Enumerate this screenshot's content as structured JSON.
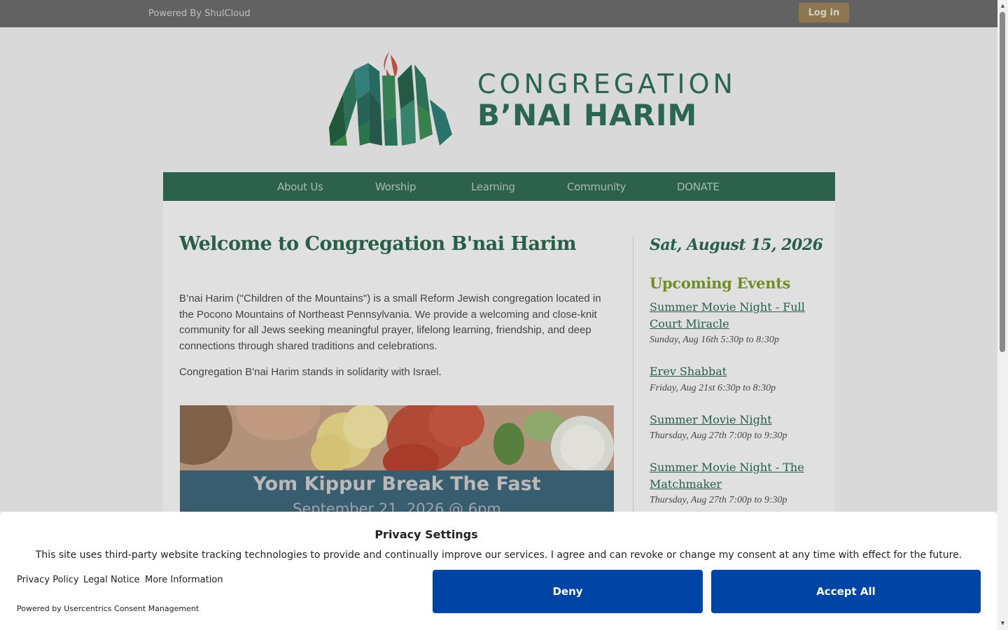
{
  "topbar": {
    "powered_by": "Powered By ShulCloud",
    "login_label": "Log in"
  },
  "logo": {
    "line1": "CONGREGATION",
    "line2": "B’NAI HARIM"
  },
  "nav": {
    "items": [
      "About Us",
      "Worship",
      "Learning",
      "Community",
      "DONATE"
    ]
  },
  "main": {
    "title": "Welcome to Congregation B'nai Harim",
    "paragraph1": "B’nai Harim (\"Children of the Mountains\") is a small Reform Jewish congregation located in the Pocono Mountains of Northeast Pennsylvania. We provide a welcoming and close-knit community for all Jews seeking meaningful prayer, lifelong learning, friendship, and deep connections through shared traditions and celebrations.",
    "paragraph2": "Congregation B'nai Harim stands in solidarity with Israel.",
    "banner": {
      "title": "Yom Kippur Break The Fast",
      "subtitle": "September 21, 2026 @ 6pm"
    }
  },
  "sidebar": {
    "date": "Sat, August 15, 2026",
    "upcoming_heading": "Upcoming Events",
    "events": [
      {
        "title": "Summer Movie Night - Full Court Miracle",
        "time": "Sunday, Aug 16th 5:30p to 8:30p"
      },
      {
        "title": "Erev Shabbat",
        "time": "Friday, Aug 21st 6:30p to 8:30p"
      },
      {
        "title": "Summer Movie Night",
        "time": "Thursday, Aug 27th 7:00p to 9:30p"
      },
      {
        "title": "Summer Movie Night - The Matchmaker",
        "time": "Thursday, Aug 27th 7:00p to 9:30p"
      }
    ]
  },
  "consent": {
    "title": "Privacy Settings",
    "text": "This site uses third-party website tracking technologies to provide and continually improve our services. I agree and can revoke or change my consent at any time with effect for the future.",
    "links": [
      "Privacy Policy",
      "Legal Notice",
      "More Information"
    ],
    "powered_by": "Powered by Usercentrics Consent Management",
    "deny_label": "Deny",
    "accept_label": "Accept All"
  },
  "colors": {
    "brand_green": "#2f6a54",
    "accent_olive": "#7c9a2c",
    "consent_blue": "#0045a5",
    "login_gold": "#9a8259"
  },
  "icons": [
    "scroll-up-arrow-icon",
    "scroll-down-arrow-icon",
    "logo-mountain-flame-icon"
  ]
}
